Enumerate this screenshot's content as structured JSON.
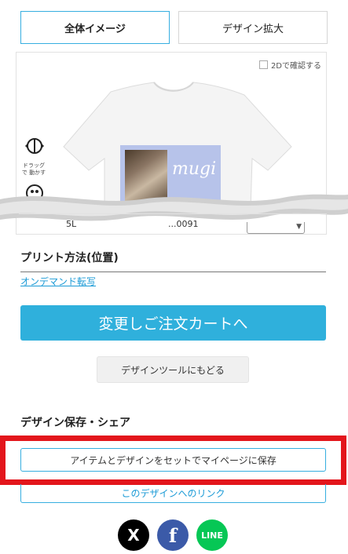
{
  "tabs": [
    {
      "label": "全体イメージ",
      "active": true
    },
    {
      "label": "デザイン拡大",
      "active": false
    }
  ],
  "viewer": {
    "toggle_2d_label": "2Dで確認する",
    "drag_hint": "ドラッグで 動かす",
    "print_text": "mugi",
    "partial_row": {
      "left": "5L",
      "middle": "...0091"
    }
  },
  "print_method": {
    "heading": "プリント方法(位置)",
    "link": "オンデマンド転写"
  },
  "buttons": {
    "order": "変更しご注文カートへ",
    "back_to_tool": "デザインツールにもどる"
  },
  "save_share": {
    "heading": "デザイン保存・シェア",
    "save_button": "アイテムとデザインをセットでマイページに保存",
    "link_button": "このデザインへのリンク"
  },
  "social": {
    "x_label": "X",
    "facebook_label": "f",
    "line_label": "LINE"
  },
  "colors": {
    "accent": "#2fb0dc",
    "highlight": "#e3161c",
    "facebook": "#3b5aa8",
    "line": "#06c755"
  }
}
